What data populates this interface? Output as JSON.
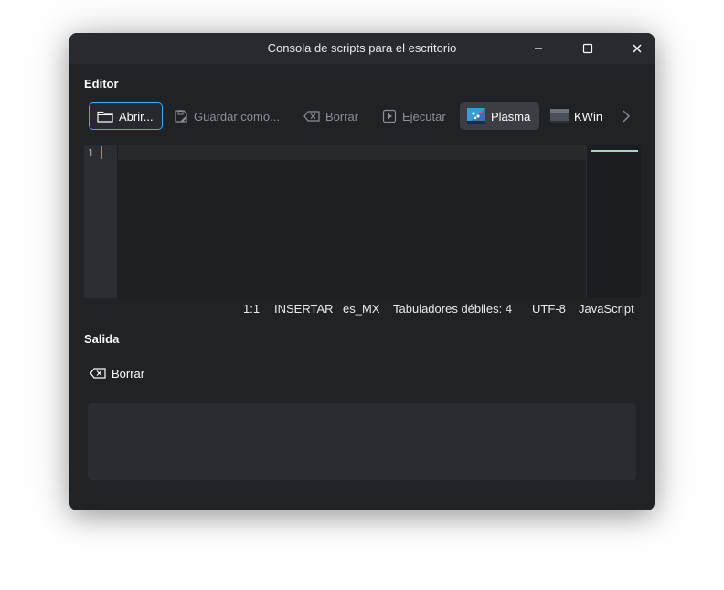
{
  "window": {
    "title": "Consola de scripts para el escritorio",
    "controls": {
      "minimize": "–",
      "maximize": "□",
      "close": "✕"
    }
  },
  "editor": {
    "label": "Editor",
    "toolbar": {
      "open": "Abrir...",
      "save_as": "Guardar como...",
      "clear": "Borrar",
      "run": "Ejecutar",
      "plasma": "Plasma",
      "kwin": "KWin",
      "more": "›"
    },
    "line_number": "1"
  },
  "status": {
    "position": "1:1",
    "mode": "INSERTAR",
    "dictionary": "es_MX",
    "indent": "Tabuladores débiles: 4",
    "encoding": "UTF-8",
    "language": "JavaScript"
  },
  "output": {
    "label": "Salida",
    "clear": "Borrar",
    "text": ""
  },
  "colors": {
    "window_bg": "#202326",
    "focus_border": "#3daee9",
    "cursor": "#f67400",
    "active_button_bg": "#3b3f44"
  }
}
